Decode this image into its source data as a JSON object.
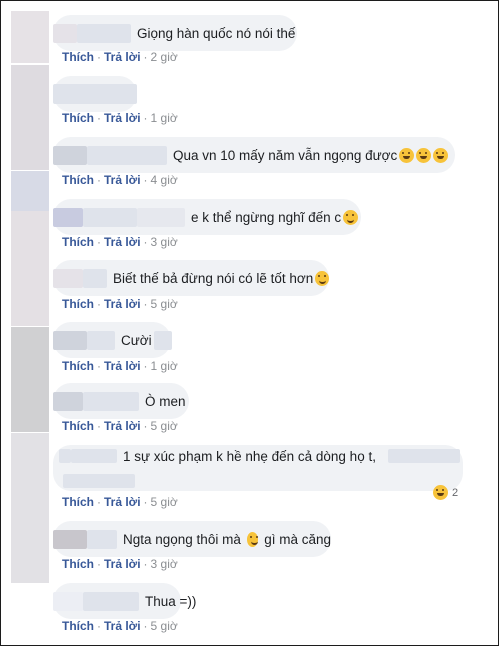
{
  "colors": {
    "link": "#385898",
    "meta": "#8a8d91",
    "bubble": "#f0f2f5",
    "emoji": "#f7c33a"
  },
  "actions": {
    "like": "Thích",
    "reply": "Trả lời",
    "separator": "·"
  },
  "comments": [
    {
      "text": "Giọng hàn quốc nó nói thế",
      "time": "2 giờ"
    },
    {
      "text": "",
      "time": "1 giờ"
    },
    {
      "text": "Qua vn 10 mấy năm vẫn ngọng được",
      "time": "4 giờ",
      "emoji": "laughing-tears-icon"
    },
    {
      "text": "e k thể ngừng nghĩ đến c",
      "time": "3 giờ",
      "emoji": "grin-icon"
    },
    {
      "text": "Biết thế bả đừng nói có lẽ tốt hơn",
      "time": "5 giờ",
      "emoji": "smile-icon"
    },
    {
      "text": "Cười",
      "time": "1 giờ"
    },
    {
      "text": "Ò men",
      "time": "5 giờ"
    },
    {
      "text": "1 sự xúc phạm k hề nhẹ đến cả dòng họ t,",
      "time": "5 giờ",
      "reaction_count": "2",
      "reaction_icon": "laughing-tears-icon"
    },
    {
      "text": "Ngta ngọng thôi mà",
      "text_after": "gì mà căng",
      "time": "3 giờ",
      "emoji": "smile-icon"
    },
    {
      "text": "Thua =))",
      "time": "5 giờ"
    }
  ]
}
